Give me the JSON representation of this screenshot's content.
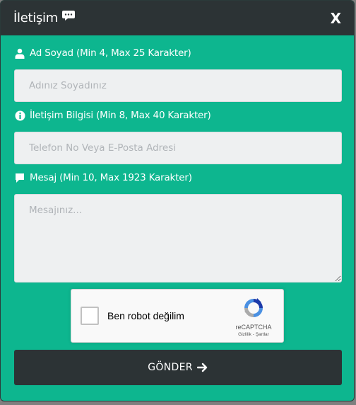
{
  "header": {
    "title": "İletişim",
    "close_label": "X"
  },
  "fields": {
    "name": {
      "label": "Ad Soyad (Min 4, Max 25 Karakter)",
      "placeholder": "Adınız Soyadınız",
      "value": ""
    },
    "contact": {
      "label": "İletişim Bilgisi (Min 8, Max 40 Karakter)",
      "placeholder": "Telefon No Veya E-Posta Adresi",
      "value": ""
    },
    "message": {
      "label": "Mesaj (Min 10, Max 1923 Karakter)",
      "placeholder": "Mesajınız...",
      "value": ""
    }
  },
  "captcha": {
    "text": "Ben robot değilim",
    "brand": "reCAPTCHA",
    "links": "Gizlilik - Şartlar"
  },
  "submit": {
    "label": "GÖNDER"
  },
  "colors": {
    "modal_bg": "#0db68f",
    "header_bg": "#2c3335",
    "button_bg": "#2c3335",
    "input_bg": "#eef0f1"
  }
}
